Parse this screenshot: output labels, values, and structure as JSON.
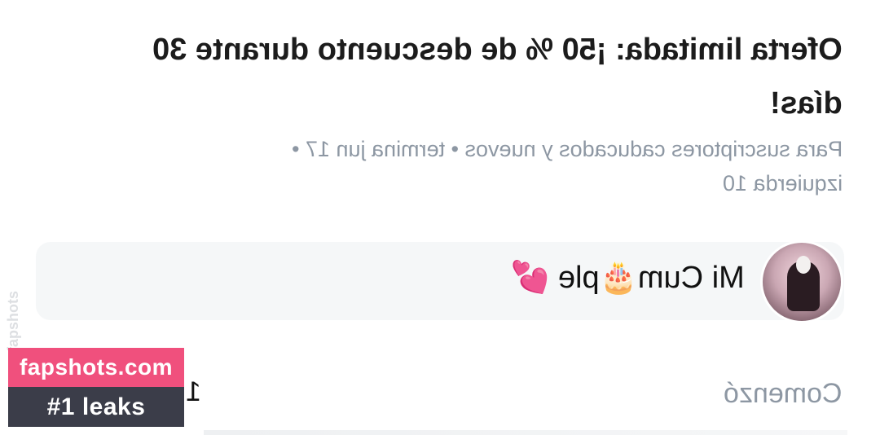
{
  "offer": {
    "title_line1": "Oferta limitada: ¡50 % de descuento durante 30",
    "title_line2": "días!",
    "subtitle_line1": "Para suscriptores caducados y nuevos  •  termina jun 17  •",
    "subtitle_line2": "izquierda 10"
  },
  "message": {
    "text": "Mi Cum🎂ple 💕",
    "avatar_icon": "user-avatar"
  },
  "footer": {
    "started_label": "Comenzó",
    "partial_value": "1"
  },
  "watermark": {
    "site": "fapshots.com",
    "tag": "#1 leaks",
    "side_text": "fapshots",
    "site_color": "#f0507d",
    "tag_color": "#3b3d49"
  }
}
